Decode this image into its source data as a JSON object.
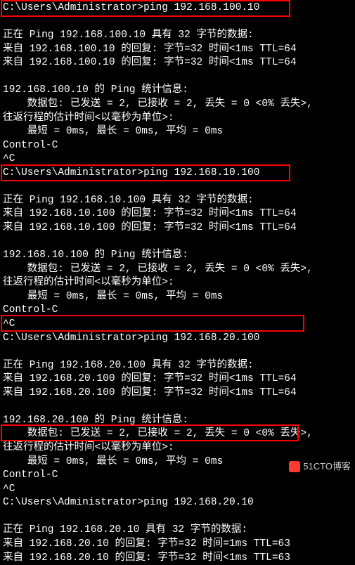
{
  "blocks": [
    {
      "prompt": "C:\\Users\\Administrator>ping 192.168.100.10",
      "blank1": "",
      "header": "正在 Ping 192.168.100.10 具有 32 字节的数据:",
      "reply1": "来自 192.168.100.10 的回复: 字节=32 时间<1ms TTL=64",
      "reply2": "来自 192.168.100.10 的回复: 字节=32 时间<1ms TTL=64",
      "blank2": "",
      "stats_title": "192.168.100.10 的 Ping 统计信息:",
      "stats_packets": "    数据包: 已发送 = 2, 已接收 = 2, 丢失 = 0 <0% 丢失>,",
      "rtt_title": "往返行程的估计时间<以毫秒为单位>:",
      "rtt_values": "    最短 = 0ms, 最长 = 0ms, 平均 = 0ms",
      "ctrlc": "Control-C",
      "caret": "^C"
    },
    {
      "prompt": "C:\\Users\\Administrator>ping 192.168.10.100",
      "blank1": "",
      "header": "正在 Ping 192.168.10.100 具有 32 字节的数据:",
      "reply1": "来自 192.168.10.100 的回复: 字节=32 时间<1ms TTL=64",
      "reply2": "来自 192.168.10.100 的回复: 字节=32 时间<1ms TTL=64",
      "blank2": "",
      "stats_title": "192.168.10.100 的 Ping 统计信息:",
      "stats_packets": "    数据包: 已发送 = 2, 已接收 = 2, 丢失 = 0 <0% 丢失>,",
      "rtt_title": "往返行程的估计时间<以毫秒为单位>:",
      "rtt_values": "    最短 = 0ms, 最长 = 0ms, 平均 = 0ms",
      "ctrlc": "Control-C",
      "caret": "^C"
    },
    {
      "prompt": "C:\\Users\\Administrator>ping 192.168.20.100",
      "blank1": "",
      "header": "正在 Ping 192.168.20.100 具有 32 字节的数据:",
      "reply1": "来自 192.168.20.100 的回复: 字节=32 时间<1ms TTL=64",
      "reply2": "来自 192.168.20.100 的回复: 字节=32 时间<1ms TTL=64",
      "blank2": "",
      "stats_title": "192.168.20.100 的 Ping 统计信息:",
      "stats_packets": "    数据包: 已发送 = 2, 已接收 = 2, 丢失 = 0 <0% 丢失>,",
      "rtt_title": "往返行程的估计时间<以毫秒为单位>:",
      "rtt_values": "    最短 = 0ms, 最长 = 0ms, 平均 = 0ms",
      "ctrlc": "Control-C",
      "caret": "^C"
    },
    {
      "prompt": "C:\\Users\\Administrator>ping 192.168.20.10",
      "blank1": "",
      "header": "正在 Ping 192.168.20.10 具有 32 字节的数据:",
      "reply1": "来自 192.168.20.10 的回复: 字节=32 时间=1ms TTL=63",
      "reply2": "来自 192.168.20.10 的回复: 字节=32 时间<1ms TTL=63"
    }
  ],
  "highlight_positions": [
    0,
    234,
    448,
    604
  ],
  "watermark": "51CTO博客"
}
